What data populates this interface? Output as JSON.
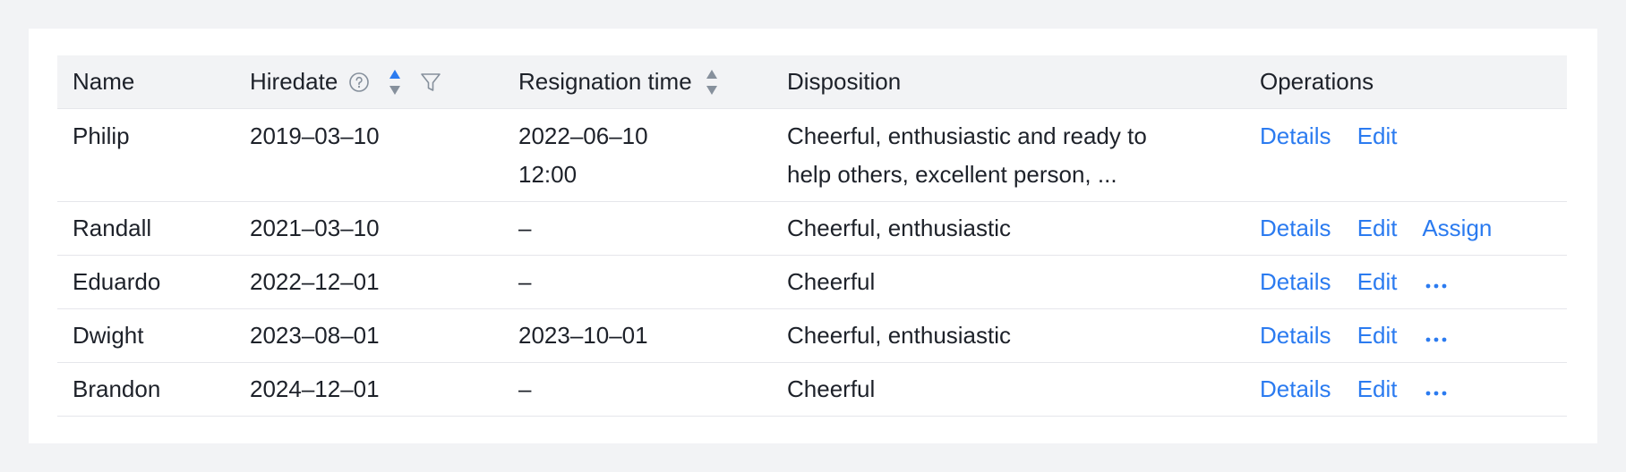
{
  "columns": {
    "name": "Name",
    "hiredate": "Hiredate",
    "resignation": "Resignation time",
    "disposition": "Disposition",
    "operations": "Operations"
  },
  "rows": [
    {
      "name": "Philip",
      "hiredate": "2019–03–10",
      "resignation_line1": "2022–06–10",
      "resignation_line2": "12:00",
      "disposition_line1": "Cheerful, enthusiastic and ready to",
      "disposition_line2": "help others,  excellent person,  ...",
      "ops": [
        "Details",
        "Edit"
      ]
    },
    {
      "name": "Randall",
      "hiredate": "2021–03–10",
      "resignation": "–",
      "disposition": "Cheerful, enthusiastic",
      "ops": [
        "Details",
        "Edit",
        "Assign"
      ]
    },
    {
      "name": "Eduardo",
      "hiredate": "2022–12–01",
      "resignation": "–",
      "disposition": "Cheerful",
      "ops": [
        "Details",
        "Edit"
      ],
      "more": true
    },
    {
      "name": "Dwight",
      "hiredate": "2023–08–01",
      "resignation": "2023–10–01",
      "disposition": "Cheerful, enthusiastic",
      "ops": [
        "Details",
        "Edit"
      ],
      "more": true
    },
    {
      "name": "Brandon",
      "hiredate": "2024–12–01",
      "resignation": "–",
      "disposition": "Cheerful",
      "ops": [
        "Details",
        "Edit"
      ],
      "more": true
    }
  ],
  "icons": {
    "help": "question-circle-icon",
    "sort": "sort-caret-icon",
    "filter": "filter-icon",
    "more": "more-dots-icon"
  },
  "colors": {
    "link": "#2b7bf0",
    "sort_active": "#2b7bf0",
    "sort_inactive": "#86909c",
    "header_bg": "#f2f3f5",
    "border": "#e5e6eb"
  },
  "sort_state": {
    "hiredate": "ascending",
    "resignation": "none"
  }
}
